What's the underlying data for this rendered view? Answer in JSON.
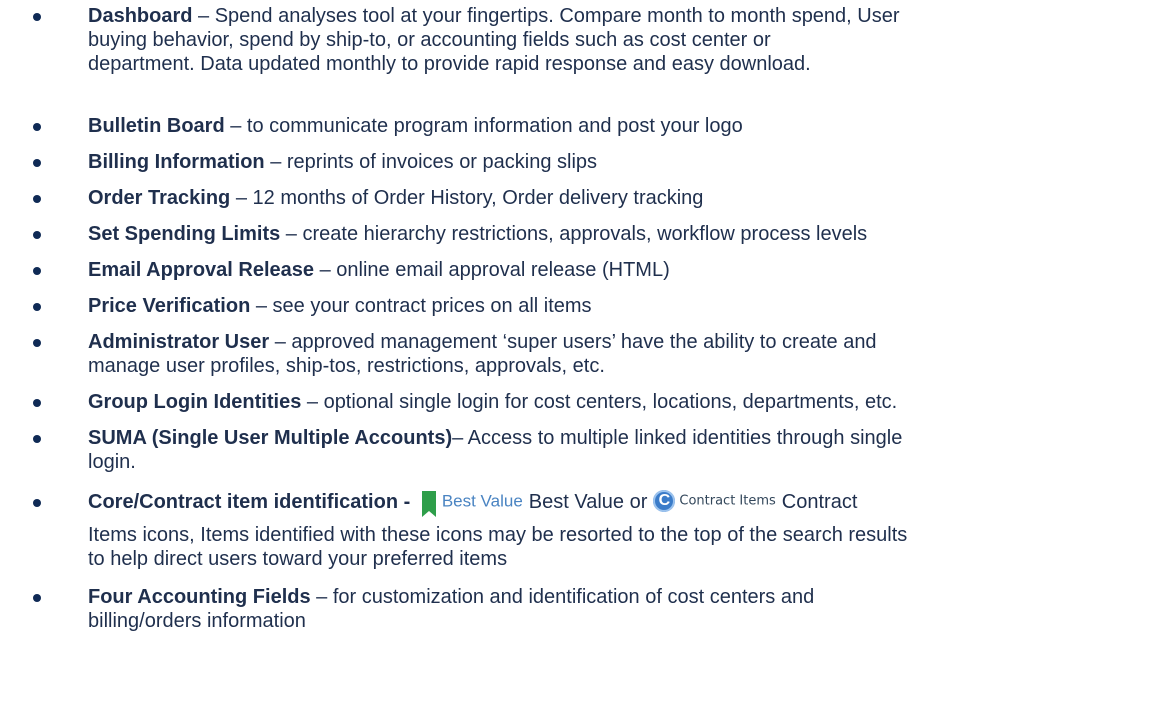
{
  "items": [
    {
      "title": "Dashboard",
      "lines": [
        " – Spend analyses tool at your fingertips.  Compare month to month spend, User",
        "buying behavior, spend by ship-to, or accounting fields such as cost center or",
        " department.  Data updated monthly to provide rapid response and easy download."
      ]
    },
    {
      "title": "Bulletin Board",
      "lines": [
        " – to communicate program information and post your logo"
      ]
    },
    {
      "title": "Billing Information",
      "lines": [
        " – reprints of invoices or packing slips"
      ]
    },
    {
      "title": "Order Tracking",
      "lines": [
        " – 12 months of Order History, Order delivery tracking"
      ]
    },
    {
      "title": "Set Spending Limits",
      "lines": [
        " – create hierarchy restrictions, approvals, workflow process levels"
      ]
    },
    {
      "title": "Email Approval Release",
      "lines": [
        " – online email approval release (HTML)"
      ]
    },
    {
      "title": "Price Verification",
      "lines": [
        " – see your contract prices on all items"
      ]
    },
    {
      "title": "Administrator User",
      "lines": [
        " – approved management ‘super users’ have the ability to create and",
        "manage user profiles, ship-tos, restrictions, approvals, etc."
      ]
    },
    {
      "title": "Group Login Identities",
      "lines": [
        " – optional single login for cost centers, locations, departments, etc."
      ]
    },
    {
      "title": "SUMA (Single User Multiple Accounts)",
      "lines": [
        "– Access to multiple linked identities through single",
        "login."
      ]
    },
    {
      "title": "Core/Contract item identification - ",
      "badge_best_value": "Best Value",
      "text_after_bv": "Best Value or",
      "badge_contract": "Contract Items",
      "text_after_ci": "Contract",
      "lines": [
        "Items icons, Items identified with these icons may be resorted to the top of the search results",
        "to help direct users toward your preferred items"
      ]
    },
    {
      "title": "Four Accounting Fields",
      "lines": [
        " – for customization and identification of cost centers and",
        "billing/orders information"
      ]
    }
  ]
}
